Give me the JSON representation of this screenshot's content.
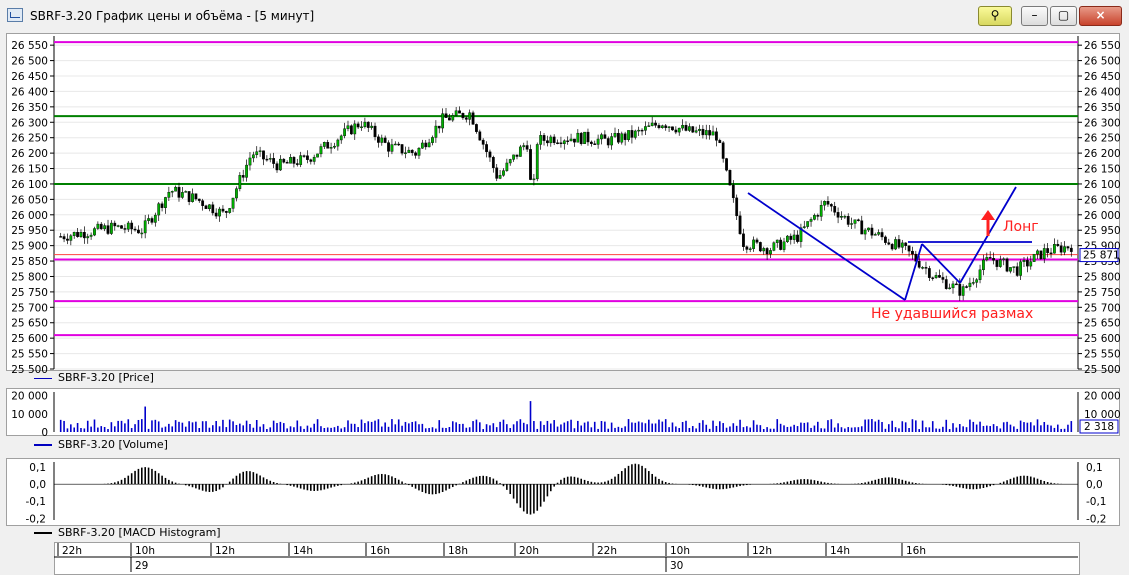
{
  "window": {
    "title": "SBRF-3.20 График цены и объёма - [5 минут]",
    "close_glyph": "×",
    "min_glyph": "–",
    "max_glyph": "▢",
    "pin_glyph": "⚲"
  },
  "colors": {
    "background": "#ffffff",
    "up_candle": "#00b000",
    "down_candle": "#000000",
    "support_line": "#008000",
    "magenta_line": "#e000e0",
    "red_line": "#ff4040",
    "trend_line": "#0000cc",
    "annotation": "#ff2020",
    "volume_bar": "#0000cc",
    "macd": "#000000"
  },
  "price_panel": {
    "legend": "SBRF-3.20 [Price]",
    "current_price": "25 871",
    "y_ticks": [
      "25 500",
      "25 550",
      "25 600",
      "25 650",
      "25 700",
      "25 750",
      "25 800",
      "25 850",
      "25 900",
      "25 950",
      "26 000",
      "26 050",
      "26 100",
      "26 150",
      "26 200",
      "26 250",
      "26 300",
      "26 350",
      "26 400",
      "26 450",
      "26 500",
      "26 550"
    ],
    "annotations": {
      "long_label": "Лонг",
      "failed_label": "Не удавшийся размах"
    }
  },
  "volume_panel": {
    "legend": "SBRF-3.20 [Volume]",
    "y_ticks": [
      "0",
      "10 000",
      "20 000"
    ],
    "current_volume": "2 318"
  },
  "macd_panel": {
    "legend": "SBRF-3.20 [MACD Histogram]",
    "y_ticks": [
      "0,1",
      "0,0",
      "-0,1",
      "-0,2"
    ]
  },
  "time_axis": {
    "hour_labels": [
      "22h",
      "10h",
      "12h",
      "14h",
      "16h",
      "18h",
      "20h",
      "22h",
      "10h",
      "12h",
      "14h",
      "16h"
    ],
    "date_labels": [
      "29",
      "30"
    ]
  },
  "chart_data": {
    "type": "candlestick",
    "interval": "5 минут",
    "ylim": [
      25500,
      26570
    ],
    "horizontal_levels": [
      {
        "price": 26560,
        "color": "magenta"
      },
      {
        "price": 26320,
        "color": "green"
      },
      {
        "price": 26100,
        "color": "green"
      },
      {
        "price": 25871,
        "color": "red"
      },
      {
        "price": 25855,
        "color": "magenta"
      },
      {
        "price": 25720,
        "color": "magenta"
      },
      {
        "price": 25610,
        "color": "magenta"
      }
    ],
    "price_path": [
      [
        "22h",
        25930
      ],
      [
        "",
        25945
      ],
      [
        "",
        25960
      ],
      [
        "",
        25950
      ],
      [
        "10h",
        26080
      ],
      [
        "",
        26050
      ],
      [
        "",
        26000
      ],
      [
        "12h",
        26200
      ],
      [
        "",
        26160
      ],
      [
        "",
        26180
      ],
      [
        "14h",
        26240
      ],
      [
        "",
        26300
      ],
      [
        "",
        26220
      ],
      [
        "16h",
        26200
      ],
      [
        "",
        26310
      ],
      [
        "",
        26330
      ],
      [
        "18h",
        26120
      ],
      [
        "",
        26230
      ],
      [
        "",
        26250
      ],
      [
        "20h",
        26250
      ],
      [
        "",
        26240
      ],
      [
        "",
        26260
      ],
      [
        "22h",
        26300
      ],
      [
        "",
        26270
      ],
      [
        "",
        26260
      ],
      [
        "10h",
        25910
      ],
      [
        "",
        25890
      ],
      [
        "",
        25930
      ],
      [
        "12h",
        26040
      ],
      [
        "",
        25970
      ],
      [
        "",
        25930
      ],
      [
        "14h",
        25880
      ],
      [
        "",
        25800
      ],
      [
        "",
        25750
      ],
      [
        "16h",
        25860
      ],
      [
        "",
        25820
      ],
      [
        "",
        25880
      ],
      [
        "",
        25900
      ]
    ],
    "volume_spikes": [
      {
        "time": "10h 29",
        "value": 14000
      },
      {
        "time": "10h 30",
        "value": 17000
      }
    ],
    "volume_typical": 4000,
    "macd_min": -0.18,
    "macd_max": 0.12
  }
}
